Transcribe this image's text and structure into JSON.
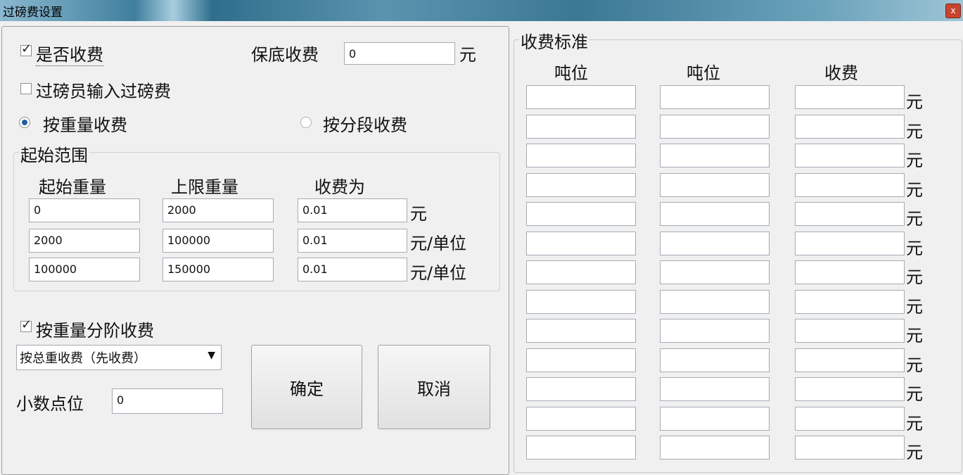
{
  "window": {
    "title": "过磅费设置",
    "close_label": "x"
  },
  "left": {
    "charge_checkbox": {
      "label": "是否收费",
      "checked": true
    },
    "min_fee": {
      "label": "保底收费",
      "value": "0",
      "unit": "元"
    },
    "operator_input": {
      "label": "过磅员输入过磅费",
      "checked": false
    },
    "radio_weight": {
      "label": "按重量收费",
      "selected": true
    },
    "radio_segment": {
      "label": "按分段收费",
      "selected": false
    },
    "range_group": {
      "legend": "起始范围",
      "headers": [
        "起始重量",
        "上限重量",
        "收费为"
      ],
      "rows": [
        {
          "start": "0",
          "limit": "2000",
          "fee": "0.01",
          "unit": "元"
        },
        {
          "start": "2000",
          "limit": "100000",
          "fee": "0.01",
          "unit": "元/单位"
        },
        {
          "start": "100000",
          "limit": "150000",
          "fee": "0.01",
          "unit": "元/单位"
        }
      ]
    },
    "tiered_checkbox": {
      "label": "按重量分阶收费",
      "checked": true
    },
    "mode_select": {
      "value": "按总重收费（先收费）"
    },
    "decimal": {
      "label": "小数点位",
      "value": "0"
    },
    "ok_label": "确定",
    "cancel_label": "取消"
  },
  "right": {
    "legend": "收费标准",
    "headers": [
      "吨位",
      "吨位",
      "收费"
    ],
    "unit": "元",
    "row_count": 13
  }
}
